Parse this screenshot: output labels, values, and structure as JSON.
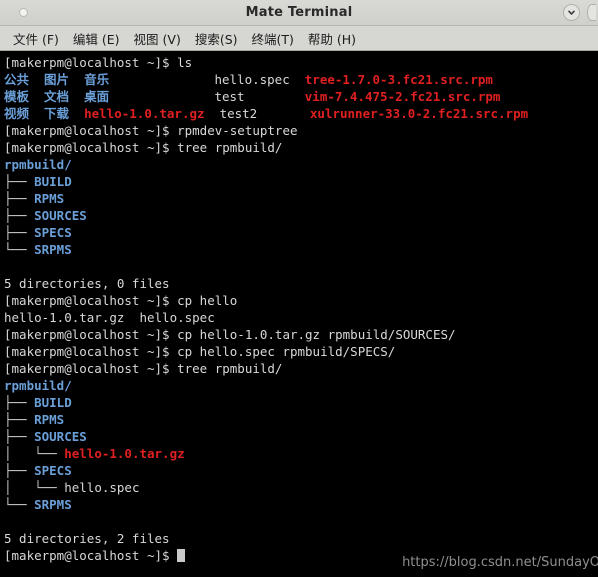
{
  "window": {
    "title": "Mate Terminal",
    "left_icon": "circle-icon",
    "buttons": [
      {
        "name": "window-menu-chevron-button",
        "icon": "chevron-down-icon"
      },
      {
        "name": "window-extra-button",
        "icon": "partial-button"
      }
    ]
  },
  "menubar": {
    "items": [
      {
        "label": "文件 (F)",
        "name": "menu-file"
      },
      {
        "label": "编辑 (E)",
        "name": "menu-edit"
      },
      {
        "label": "视图 (V)",
        "name": "menu-view"
      },
      {
        "label": "搜索(S)",
        "name": "menu-search"
      },
      {
        "label": "终端(T)",
        "name": "menu-terminal"
      },
      {
        "label": "帮助 (H)",
        "name": "menu-help"
      }
    ]
  },
  "terminal": {
    "prompt": "[makerpm@localhost ~]$ ",
    "lines": [
      {
        "segments": [
          {
            "t": "[makerpm@localhost ~]$ ls",
            "c": "white"
          }
        ]
      },
      {
        "segments": [
          {
            "t": "公共  图片  音乐              ",
            "c": "blue"
          },
          {
            "t": "hello.spec  ",
            "c": "white"
          },
          {
            "t": "tree-1.7.0-3.fc21.src.rpm",
            "c": "red"
          }
        ]
      },
      {
        "segments": [
          {
            "t": "模板  文档  桌面              ",
            "c": "blue"
          },
          {
            "t": "test        ",
            "c": "white"
          },
          {
            "t": "vim-7.4.475-2.fc21.src.rpm",
            "c": "red"
          }
        ]
      },
      {
        "segments": [
          {
            "t": "视频  下载  ",
            "c": "blue"
          },
          {
            "t": "hello-1.0.tar.gz  ",
            "c": "red"
          },
          {
            "t": "test2       ",
            "c": "white"
          },
          {
            "t": "xulrunner-33.0-2.fc21.src.rpm",
            "c": "red"
          }
        ]
      },
      {
        "segments": [
          {
            "t": "[makerpm@localhost ~]$ rpmdev-setuptree",
            "c": "white"
          }
        ]
      },
      {
        "segments": [
          {
            "t": "[makerpm@localhost ~]$ tree rpmbuild/",
            "c": "white"
          }
        ]
      },
      {
        "segments": [
          {
            "t": "rpmbuild/",
            "c": "blue"
          }
        ]
      },
      {
        "segments": [
          {
            "t": "├── ",
            "c": "tree"
          },
          {
            "t": "BUILD",
            "c": "blue"
          }
        ]
      },
      {
        "segments": [
          {
            "t": "├── ",
            "c": "tree"
          },
          {
            "t": "RPMS",
            "c": "blue"
          }
        ]
      },
      {
        "segments": [
          {
            "t": "├── ",
            "c": "tree"
          },
          {
            "t": "SOURCES",
            "c": "blue"
          }
        ]
      },
      {
        "segments": [
          {
            "t": "├── ",
            "c": "tree"
          },
          {
            "t": "SPECS",
            "c": "blue"
          }
        ]
      },
      {
        "segments": [
          {
            "t": "└── ",
            "c": "tree"
          },
          {
            "t": "SRPMS",
            "c": "blue"
          }
        ]
      },
      {
        "segments": [
          {
            "t": "",
            "c": "white"
          }
        ]
      },
      {
        "segments": [
          {
            "t": "5 directories, 0 files",
            "c": "white"
          }
        ]
      },
      {
        "segments": [
          {
            "t": "[makerpm@localhost ~]$ cp hello",
            "c": "white"
          }
        ]
      },
      {
        "segments": [
          {
            "t": "hello-1.0.tar.gz  hello.spec",
            "c": "white"
          }
        ]
      },
      {
        "segments": [
          {
            "t": "[makerpm@localhost ~]$ cp hello-1.0.tar.gz rpmbuild/SOURCES/",
            "c": "white"
          }
        ]
      },
      {
        "segments": [
          {
            "t": "[makerpm@localhost ~]$ cp hello.spec rpmbuild/SPECS/",
            "c": "white"
          }
        ]
      },
      {
        "segments": [
          {
            "t": "[makerpm@localhost ~]$ tree rpmbuild/",
            "c": "white"
          }
        ]
      },
      {
        "segments": [
          {
            "t": "rpmbuild/",
            "c": "blue"
          }
        ]
      },
      {
        "segments": [
          {
            "t": "├── ",
            "c": "tree"
          },
          {
            "t": "BUILD",
            "c": "blue"
          }
        ]
      },
      {
        "segments": [
          {
            "t": "├── ",
            "c": "tree"
          },
          {
            "t": "RPMS",
            "c": "blue"
          }
        ]
      },
      {
        "segments": [
          {
            "t": "├── ",
            "c": "tree"
          },
          {
            "t": "SOURCES",
            "c": "blue"
          }
        ]
      },
      {
        "segments": [
          {
            "t": "│   └── ",
            "c": "tree"
          },
          {
            "t": "hello-1.0.tar.gz",
            "c": "red"
          }
        ]
      },
      {
        "segments": [
          {
            "t": "├── ",
            "c": "tree"
          },
          {
            "t": "SPECS",
            "c": "blue"
          }
        ]
      },
      {
        "segments": [
          {
            "t": "│   └── ",
            "c": "tree"
          },
          {
            "t": "hello.spec",
            "c": "white"
          }
        ]
      },
      {
        "segments": [
          {
            "t": "└── ",
            "c": "tree"
          },
          {
            "t": "SRPMS",
            "c": "blue"
          }
        ]
      },
      {
        "segments": [
          {
            "t": "",
            "c": "white"
          }
        ]
      },
      {
        "segments": [
          {
            "t": "5 directories, 2 files",
            "c": "white"
          }
        ]
      },
      {
        "segments": [
          {
            "t": "[makerpm@localhost ~]$ ",
            "c": "white"
          },
          {
            "t": "",
            "c": "cursor"
          }
        ]
      }
    ],
    "watermark": "https://blog.csdn.net/SundayO"
  },
  "colors": {
    "background": "#000000",
    "foreground": "#d8d8d8",
    "directory_blue": "#6a9fd8",
    "archive_red": "#e02020",
    "titlebar": "#d4d4d0"
  }
}
